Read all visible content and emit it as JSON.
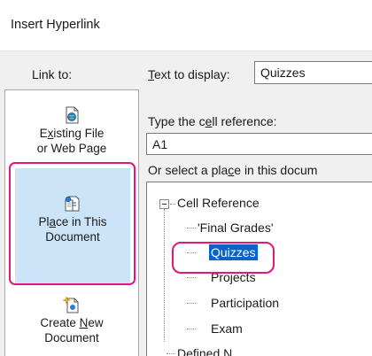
{
  "dialog": {
    "title": "Insert Hyperlink"
  },
  "link_to": {
    "label": "Link to:",
    "items": [
      {
        "line1_pre": "E",
        "line1_accel": "x",
        "line1_post": "isting File",
        "line2": "or Web Page",
        "icon": "file-globe-icon",
        "selected": false
      },
      {
        "line1_pre": "Pl",
        "line1_accel": "a",
        "line1_post": "ce in This",
        "line2": "Document",
        "icon": "document-place-icon",
        "selected": true
      },
      {
        "line1_pre": "Create ",
        "line1_accel": "N",
        "line1_post": "ew",
        "line2": "Document",
        "icon": "new-document-icon",
        "selected": false
      }
    ]
  },
  "text_to_display": {
    "label_accel": "T",
    "label_rest": "ext to display:",
    "value": "Quizzes"
  },
  "cell_reference": {
    "label_pre": "Type the c",
    "label_accel": "e",
    "label_post": "ll reference:",
    "value": "A1"
  },
  "place_select": {
    "label_pre": "Or select a pla",
    "label_accel": "c",
    "label_post": "e in this docum"
  },
  "tree": {
    "root": "Cell Reference",
    "children": [
      "'Final Grades'",
      "Quizzes",
      "Projects",
      "Participation",
      "Exam"
    ],
    "selected": "Quizzes",
    "partial_next": "Defined N"
  },
  "colors": {
    "highlight": "#e0177e",
    "selection": "#0a64c8",
    "nav_selected_bg": "#cce4f7"
  }
}
